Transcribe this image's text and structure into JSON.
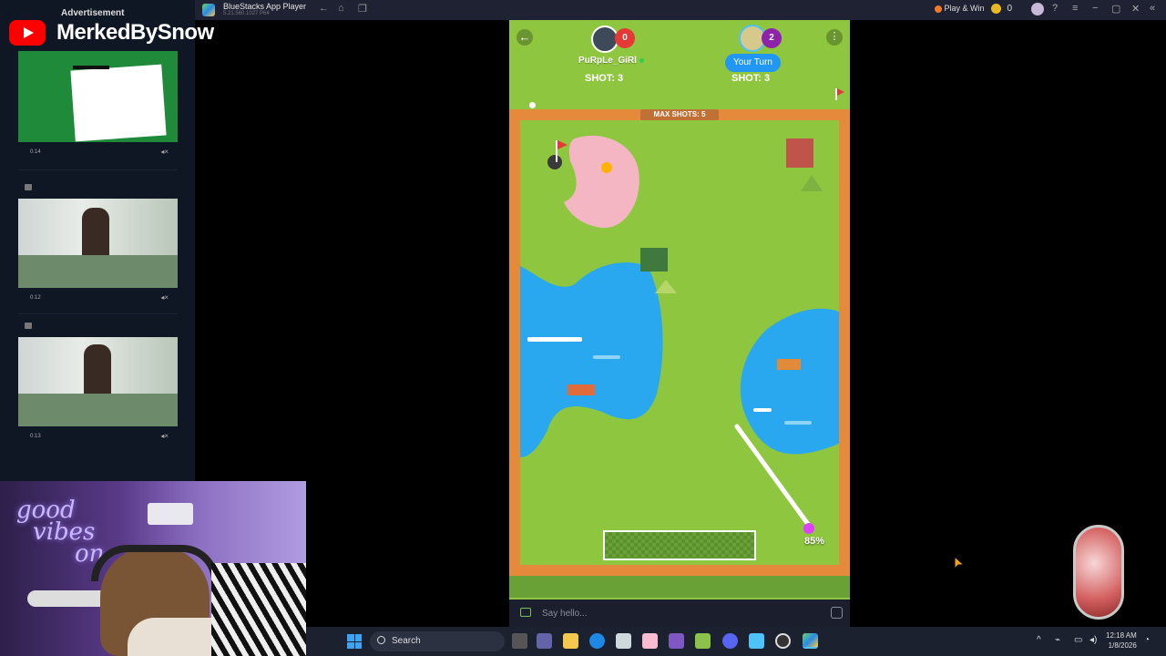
{
  "window": {
    "title": "BlueStacks App Player",
    "subtitle": "5.21.560.1027 P64",
    "play_win": "Play & Win",
    "coins": "0"
  },
  "stream": {
    "channel": "MerkedBySnow",
    "neon_text": [
      "good",
      "vibes",
      "on"
    ]
  },
  "ads": {
    "label": "Advertisement",
    "items": [
      {
        "duration": "0:14"
      },
      {
        "duration": "0:12"
      },
      {
        "duration": "0:13"
      }
    ]
  },
  "game": {
    "players": [
      {
        "name": "PuRpLe_GiRl",
        "score": "0",
        "shots": "SHOT: 3",
        "online": true
      },
      {
        "name": "Your Turn",
        "score": "2",
        "shots": "SHOT: 3"
      }
    ],
    "max_shots": "MAX SHOTS: 5",
    "power": "85%"
  },
  "chat": {
    "placeholder": "Say hello..."
  },
  "taskbar": {
    "search_label": "Search",
    "time": "12:18 AM",
    "date": "1/8/2026"
  },
  "colors": {
    "grass": "#8ec63f",
    "water": "#29a8f0",
    "green_bunker": "#f4b6c2",
    "border": "#e58a3a"
  }
}
